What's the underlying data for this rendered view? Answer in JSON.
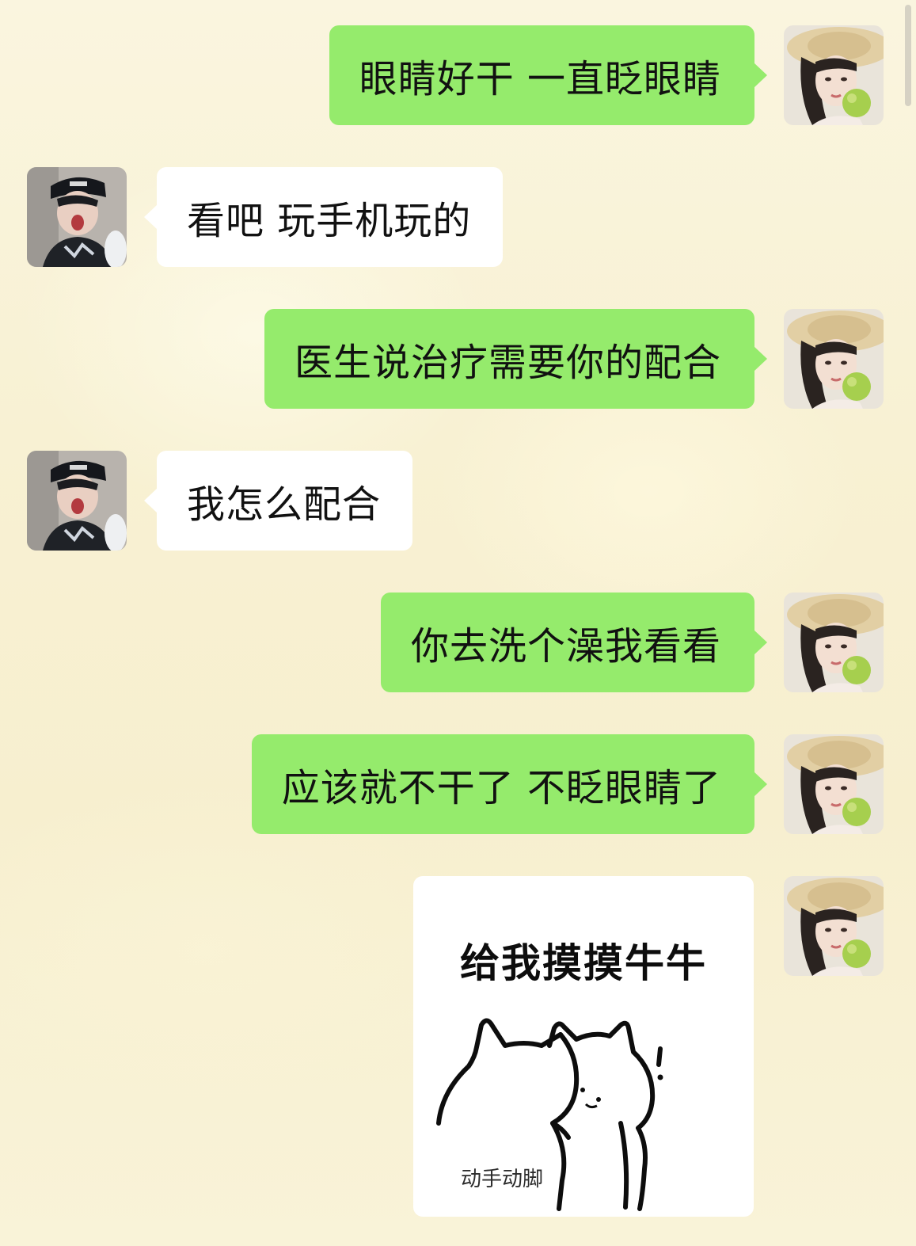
{
  "messages": [
    {
      "side": "right",
      "text": "眼睛好干 一直眨眼睛"
    },
    {
      "side": "left",
      "text": "看吧 玩手机玩的"
    },
    {
      "side": "right",
      "text": "医生说治疗需要你的配合"
    },
    {
      "side": "left",
      "text": "我怎么配合"
    },
    {
      "side": "right",
      "text": "你去洗个澡我看看"
    },
    {
      "side": "right",
      "text": "应该就不干了 不眨眼睛了"
    }
  ],
  "sticker": {
    "title": "给我摸摸牛牛",
    "caption": "动手动脚"
  },
  "colors": {
    "sent_bubble": "#95eb6c",
    "received_bubble": "#ffffff",
    "background": "#f8f1d3"
  }
}
